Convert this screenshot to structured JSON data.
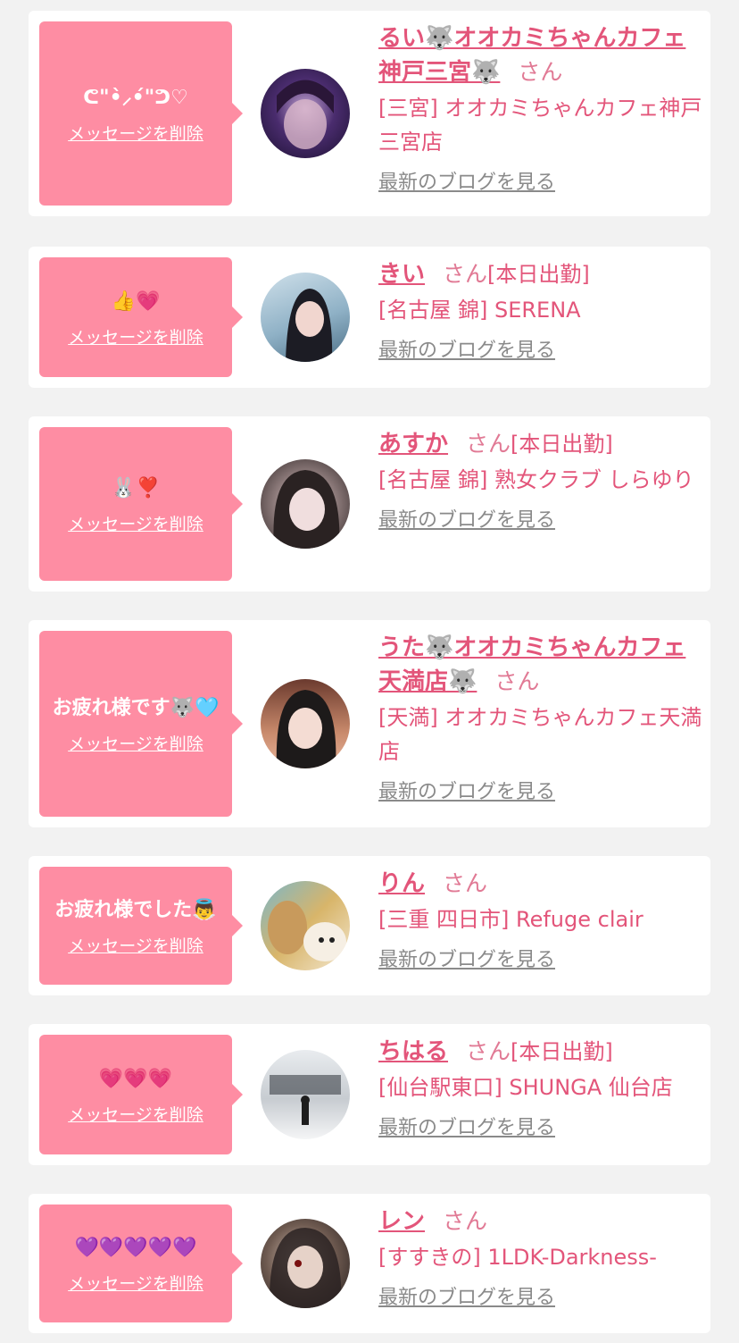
{
  "colors": {
    "page_background": "#f2f2f2",
    "bubble": "#fe8da3",
    "accent": "#e3557a",
    "link_gray": "#8a8a8a"
  },
  "common": {
    "delete_label": "メッセージを削除",
    "blog_label": "最新のブログを見る",
    "san_label": "さん"
  },
  "items": [
    {
      "message": "ᕦ\"•̀⸝•́\"ᕤ♡",
      "name": "るい🐺オオカミちゃんカフェ神戸三宮🐺",
      "attendance": "",
      "shop": "[三宮] オオカミちゃんカフェ神戸三宮店",
      "avatar_icon": "avatar-photo-rui"
    },
    {
      "message": "👍💗",
      "name": "きい",
      "attendance": "[本日出勤]",
      "shop": "[名古屋 錦] SERENA",
      "avatar_icon": "avatar-photo-kii"
    },
    {
      "message": "🐰❣️",
      "name": "あすか",
      "attendance": "[本日出勤]",
      "shop": "[名古屋 錦] 熟女クラブ しらゆり",
      "avatar_icon": "avatar-photo-asuka"
    },
    {
      "message": "お疲れ様です🐺🩵",
      "name": "うた🐺オオカミちゃんカフェ天満店🐺",
      "attendance": "",
      "shop": "[天満] オオカミちゃんカフェ天満店",
      "avatar_icon": "avatar-photo-uta"
    },
    {
      "message": "お疲れ様でした👼",
      "name": "りん",
      "attendance": "",
      "shop": "[三重 四日市] Refuge clair",
      "avatar_icon": "avatar-photo-rin"
    },
    {
      "message": "💗💗💗",
      "name": "ちはる",
      "attendance": "[本日出勤]",
      "shop": "[仙台駅東口] SHUNGA 仙台店",
      "avatar_icon": "avatar-photo-chiharu"
    },
    {
      "message": "💜💜💜💜💜",
      "name": "レン",
      "attendance": "",
      "shop": "[すすきの] 1LDK-Darkness-",
      "avatar_icon": "avatar-photo-ren"
    }
  ]
}
